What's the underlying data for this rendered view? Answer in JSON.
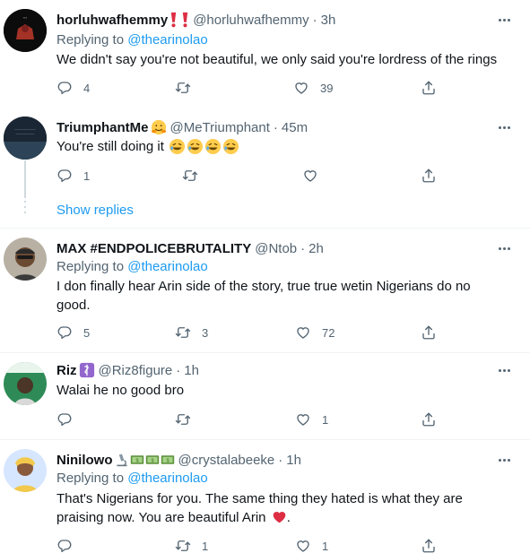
{
  "tweets": [
    {
      "name": "horluhwafhemmy",
      "handle": "@horluhwafhemmy",
      "time": "3h",
      "replying_label": "Replying to",
      "replying_to": "@thearinolao",
      "text": "We didn't say you're not beautiful, we only said you're lordress of the rings",
      "replies": "4",
      "retweets": "",
      "likes": "39"
    },
    {
      "name": "TriumphantMe",
      "handle": "@MeTriumphant",
      "time": "45m",
      "text": "You're still doing it",
      "replies": "1",
      "retweets": "",
      "likes": ""
    },
    {
      "name": "MAX #ENDPOLICEBRUTALITY",
      "handle": "@Ntob",
      "time": "2h",
      "replying_label": "Replying to",
      "replying_to": "@thearinolao",
      "text": "I don finally hear Arin side of the story, true true wetin Nigerians do no good.",
      "replies": "5",
      "retweets": "3",
      "likes": "72"
    },
    {
      "name": "Riz",
      "handle": "@Riz8figure",
      "time": "1h",
      "text": "Walai he no good bro",
      "replies": "",
      "retweets": "",
      "likes": "1"
    },
    {
      "name": "Ninilowo",
      "handle": "@crystalabeeke",
      "time": "1h",
      "replying_label": "Replying to",
      "replying_to": "@thearinolao",
      "text": "That's Nigerians for you. The same thing they hated is what they are praising now. You are beautiful Arin",
      "text_end": ".",
      "replies": "",
      "retweets": "1",
      "likes": "1"
    }
  ],
  "show_replies": "Show replies",
  "separator": "·",
  "colors": {
    "link": "#1d9bf0",
    "text": "#0f1419",
    "muted": "#536471",
    "divider": "#eff3f4",
    "emoji_red": "#e0245e",
    "emoji_yellow": "#ffcc4d"
  },
  "icons": [
    "reply-icon",
    "retweet-icon",
    "like-icon",
    "share-icon",
    "more-icon"
  ]
}
